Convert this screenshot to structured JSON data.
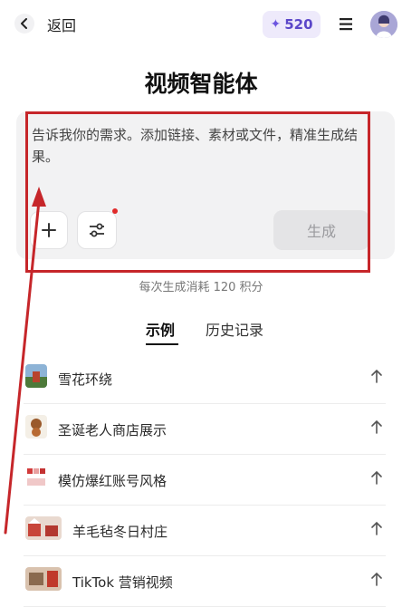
{
  "header": {
    "back_label": "返回",
    "credits": "520",
    "credits_icon": "sparkle-icon",
    "menu_icon": "menu-icon"
  },
  "title": "视频智能体",
  "prompt": {
    "placeholder": "告诉我你的需求。添加链接、素材或文件，精准生成结果。",
    "add_icon": "plus-icon",
    "settings_icon": "sliders-icon",
    "generate_label": "生成"
  },
  "cost_note": "每次生成消耗 120 积分",
  "tabs": [
    {
      "label": "示例",
      "active": true
    },
    {
      "label": "历史记录",
      "active": false
    }
  ],
  "examples": [
    {
      "label": "雪花环绕"
    },
    {
      "label": "圣诞老人商店展示"
    },
    {
      "label": "模仿爆红账号风格"
    },
    {
      "label": "羊毛毡冬日村庄"
    },
    {
      "label": "TikTok 营销视频"
    }
  ],
  "annotation_color": "#c6262a"
}
